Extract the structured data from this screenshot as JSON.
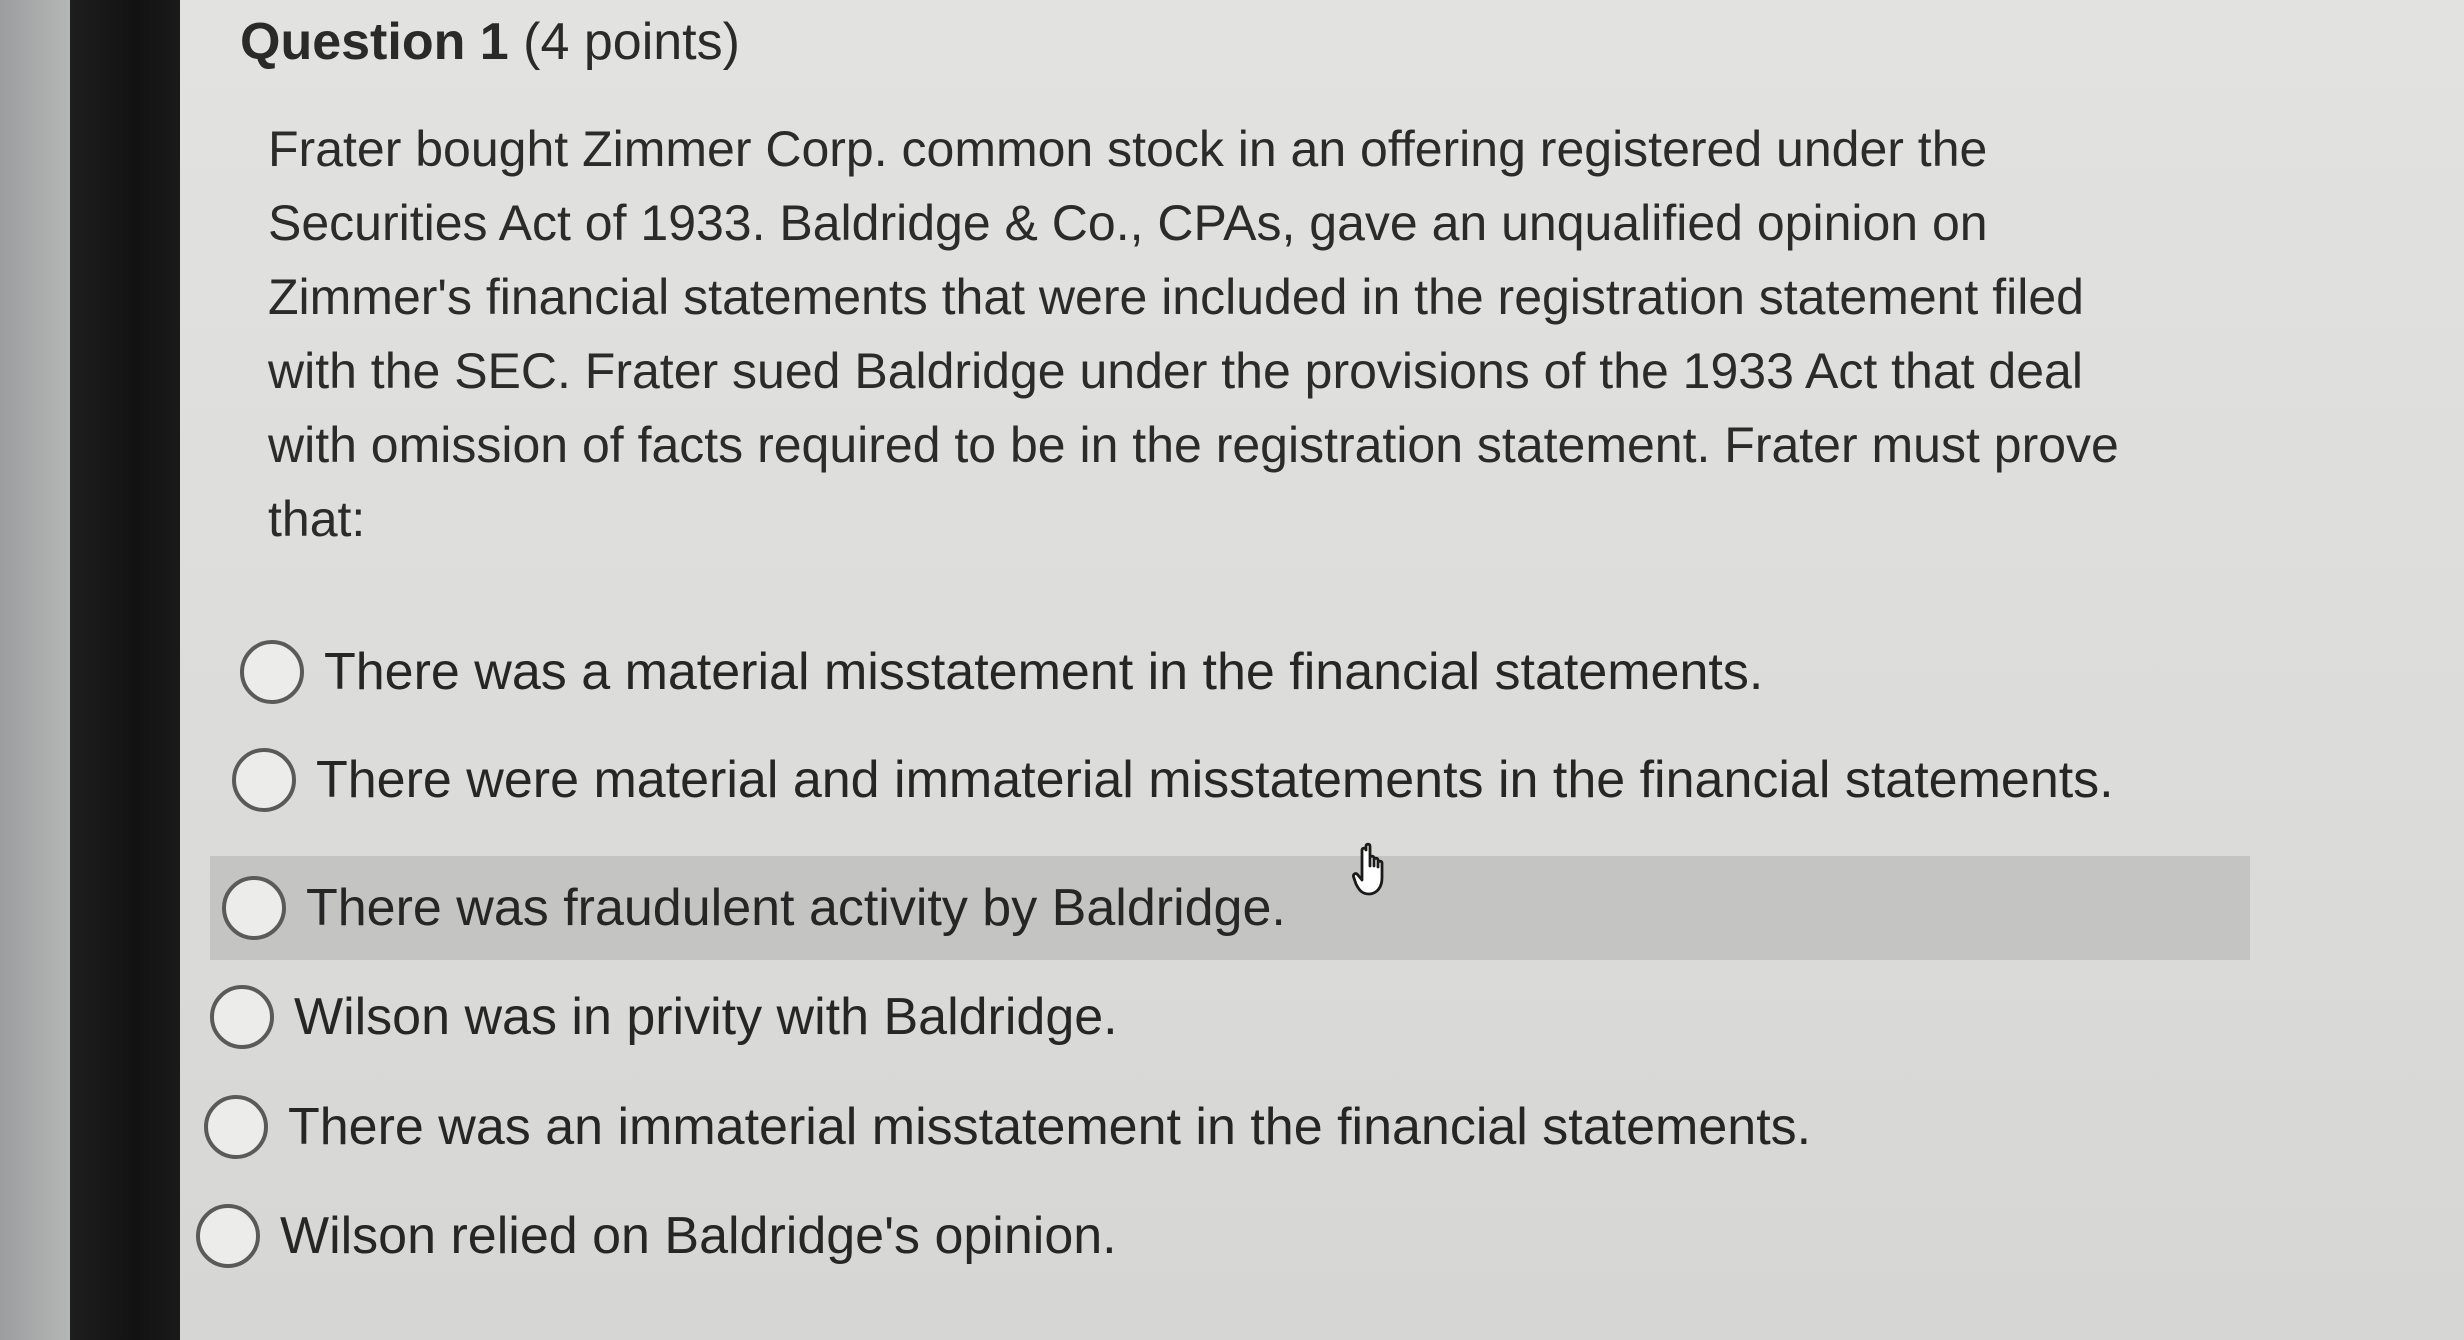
{
  "question": {
    "title": "Question 1",
    "points": "(4 points)",
    "stem": "Frater bought Zimmer Corp. common stock in an offering registered under the\nSecurities Act of 1933. Baldridge & Co., CPAs, gave an unqualified opinion on\nZimmer's financial statements that were included in the registration statement filed\nwith the SEC. Frater sued Baldridge under the provisions of the 1933 Act that deal\nwith omission of facts required to be in the registration statement. Frater must prove\nthat:"
  },
  "options": [
    {
      "label": "There was a material misstatement in the financial statements.",
      "selected": false,
      "hovered": false
    },
    {
      "label": "There were material and immaterial misstatements in the financial statements.",
      "selected": false,
      "hovered": false
    },
    {
      "label": "There was fraudulent activity by Baldridge.",
      "selected": false,
      "hovered": true
    },
    {
      "label": "Wilson was in privity with Baldridge.",
      "selected": false,
      "hovered": false
    },
    {
      "label": "There was an immaterial misstatement in the financial statements.",
      "selected": false,
      "hovered": false
    },
    {
      "label": "Wilson relied on Baldridge's opinion.",
      "selected": false,
      "hovered": false
    }
  ],
  "cursor": {
    "icon": "hand-pointer-icon"
  },
  "colors": {
    "screen_bg": "#dedede",
    "hover_row": "#c4c4c3",
    "text": "#2b2b2b",
    "bezel": "#161617"
  }
}
